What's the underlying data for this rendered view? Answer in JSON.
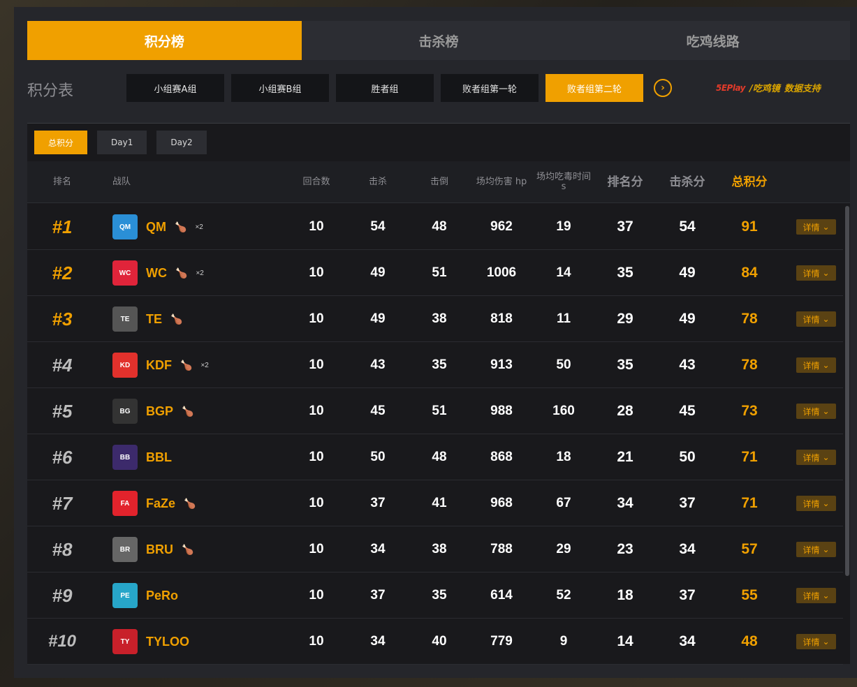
{
  "main_tabs": [
    {
      "label": "积分榜",
      "active": true
    },
    {
      "label": "击杀榜",
      "active": false
    },
    {
      "label": "吃鸡线路",
      "active": false
    }
  ],
  "table_title": "积分表",
  "stages": [
    {
      "label": "小组赛A组",
      "active": false
    },
    {
      "label": "小组赛B组",
      "active": false
    },
    {
      "label": "胜者组",
      "active": false
    },
    {
      "label": "败者组第一轮",
      "active": false
    },
    {
      "label": "败者组第二轮",
      "active": true
    }
  ],
  "sponsor": {
    "logo": "5EPlay",
    "logo2": "/吃鸡镜",
    "text": "数据支持"
  },
  "day_tabs": [
    {
      "label": "总积分",
      "active": true
    },
    {
      "label": "Day1",
      "active": false
    },
    {
      "label": "Day2",
      "active": false
    }
  ],
  "headers": {
    "rank": "排名",
    "team": "战队",
    "rounds": "回合数",
    "kills": "击杀",
    "knocks": "击倒",
    "avg_damage": "场均伤害 hp",
    "avg_poison_time": "场均吃毒时间 s",
    "place_pts": "排名分",
    "kill_pts": "击杀分",
    "total_pts": "总积分"
  },
  "detail_label": "详情",
  "rows": [
    {
      "rank": "#1",
      "team": "QM",
      "chicken": "×2",
      "logo_color": "#2a8fd6",
      "rounds": "10",
      "kills": "54",
      "knocks": "48",
      "dmg": "962",
      "poison": "19",
      "place": "37",
      "killpts": "54",
      "total": "91"
    },
    {
      "rank": "#2",
      "team": "WC",
      "chicken": "×2",
      "logo_color": "#e0243a",
      "rounds": "10",
      "kills": "49",
      "knocks": "51",
      "dmg": "1006",
      "poison": "14",
      "place": "35",
      "killpts": "49",
      "total": "84"
    },
    {
      "rank": "#3",
      "team": "TE",
      "chicken": "",
      "logo_color": "#555555",
      "rounds": "10",
      "kills": "49",
      "knocks": "38",
      "dmg": "818",
      "poison": "11",
      "place": "29",
      "killpts": "49",
      "total": "78"
    },
    {
      "rank": "#4",
      "team": "KDF",
      "chicken": "×2",
      "logo_color": "#e2312c",
      "rounds": "10",
      "kills": "43",
      "knocks": "35",
      "dmg": "913",
      "poison": "50",
      "place": "35",
      "killpts": "43",
      "total": "78"
    },
    {
      "rank": "#5",
      "team": "BGP",
      "chicken": "",
      "logo_color": "#333333",
      "rounds": "10",
      "kills": "45",
      "knocks": "51",
      "dmg": "988",
      "poison": "160",
      "place": "28",
      "killpts": "45",
      "total": "73"
    },
    {
      "rank": "#6",
      "team": "BBL",
      "chicken": "",
      "logo_color": "#3c2a6b",
      "rounds": "10",
      "kills": "50",
      "knocks": "48",
      "dmg": "868",
      "poison": "18",
      "place": "21",
      "killpts": "50",
      "total": "71"
    },
    {
      "rank": "#7",
      "team": "FaZe",
      "chicken": "",
      "logo_color": "#e2232c",
      "rounds": "10",
      "kills": "37",
      "knocks": "41",
      "dmg": "968",
      "poison": "67",
      "place": "34",
      "killpts": "37",
      "total": "71"
    },
    {
      "rank": "#8",
      "team": "BRU",
      "chicken": "",
      "logo_color": "#666666",
      "rounds": "10",
      "kills": "34",
      "knocks": "38",
      "dmg": "788",
      "poison": "29",
      "place": "23",
      "killpts": "34",
      "total": "57"
    },
    {
      "rank": "#9",
      "team": "PeRo",
      "chicken": "",
      "logo_color": "#27a6c9",
      "rounds": "10",
      "kills": "37",
      "knocks": "35",
      "dmg": "614",
      "poison": "52",
      "place": "18",
      "killpts": "37",
      "total": "55"
    },
    {
      "rank": "#10",
      "team": "TYLOO",
      "chicken": "",
      "logo_color": "#c8202a",
      "rounds": "10",
      "kills": "34",
      "knocks": "40",
      "dmg": "779",
      "poison": "9",
      "place": "14",
      "killpts": "34",
      "total": "48"
    }
  ]
}
